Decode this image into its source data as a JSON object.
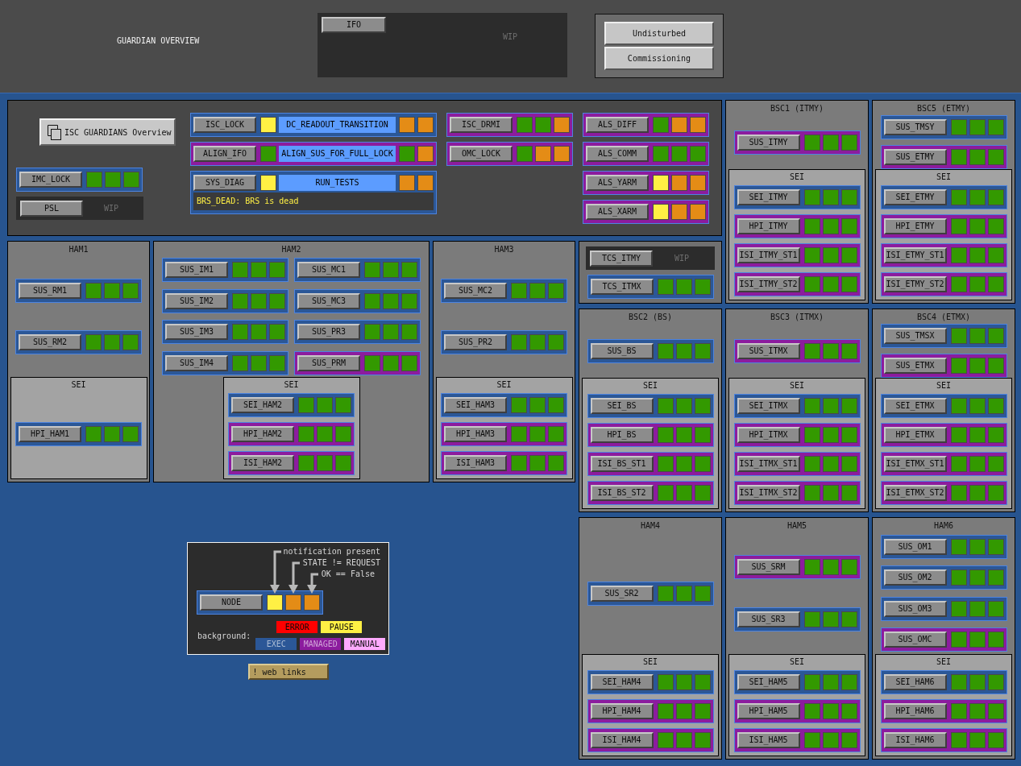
{
  "header": {
    "title": "GUARDIAN OVERVIEW",
    "ifo": {
      "name": "IFO",
      "label": "WIP"
    },
    "modes": [
      "Undisturbed",
      "Commissioning"
    ]
  },
  "isc": {
    "overview_button": "ISC GUARDIANS Overview",
    "columns": [
      [
        {
          "kind": "node",
          "name": "IMC_LOCK",
          "managed": false,
          "notification": false,
          "state_differs": false,
          "not_ok": false
        },
        {
          "kind": "wip",
          "name": "PSL",
          "label": "WIP"
        }
      ],
      [
        {
          "kind": "node",
          "name": "ISC_LOCK",
          "managed": false,
          "notification": true,
          "state": "DC_READOUT_TRANSITION",
          "state_differs": true,
          "not_ok": true
        },
        {
          "kind": "node",
          "name": "ALIGN_IFO",
          "managed": true,
          "notification": false,
          "state": "ALIGN_SUS_FOR_FULL_LOCK",
          "state_differs": false,
          "not_ok": true
        },
        {
          "kind": "node",
          "name": "SYS_DIAG",
          "managed": false,
          "notification": true,
          "state": "RUN_TESTS",
          "state_differs": true,
          "not_ok": true,
          "message": "BRS_DEAD: BRS is dead"
        }
      ],
      [
        {
          "kind": "node",
          "name": "ISC_DRMI",
          "managed": true,
          "notification": false,
          "state_differs": false,
          "not_ok": true
        },
        {
          "kind": "node",
          "name": "OMC_LOCK",
          "managed": true,
          "notification": false,
          "state_differs": true,
          "not_ok": true
        }
      ],
      [
        {
          "kind": "node",
          "name": "ALS_DIFF",
          "managed": true,
          "notification": false,
          "state_differs": true,
          "not_ok": true
        },
        {
          "kind": "node",
          "name": "ALS_COMM",
          "managed": true,
          "notification": false,
          "state_differs": false,
          "not_ok": false
        },
        {
          "kind": "node",
          "name": "ALS_YARM",
          "managed": true,
          "notification": true,
          "state_differs": true,
          "not_ok": true
        },
        {
          "kind": "node",
          "name": "ALS_XARM",
          "managed": true,
          "notification": true,
          "state_differs": true,
          "not_ok": true
        }
      ]
    ]
  },
  "bsc_top": [
    {
      "title": "BSC1 (ITMY)",
      "nodes": [
        {
          "name": "SUS_ITMY",
          "managed": true,
          "notification": false,
          "state_differs": false,
          "not_ok": false
        }
      ],
      "sei": {
        "title": "SEI",
        "nodes": [
          {
            "name": "SEI_ITMY",
            "managed": false,
            "notification": false,
            "state_differs": false,
            "not_ok": false
          },
          {
            "name": "HPI_ITMY",
            "managed": true,
            "notification": false,
            "state_differs": false,
            "not_ok": false
          },
          {
            "name": "ISI_ITMY_ST1",
            "managed": true,
            "notification": false,
            "state_differs": false,
            "not_ok": false
          },
          {
            "name": "ISI_ITMY_ST2",
            "managed": true,
            "notification": false,
            "state_differs": false,
            "not_ok": false
          }
        ]
      }
    },
    {
      "title": "BSC5 (ETMY)",
      "nodes": [
        {
          "name": "SUS_TMSY",
          "managed": false,
          "notification": false,
          "state_differs": false,
          "not_ok": false
        },
        {
          "name": "SUS_ETMY",
          "managed": true,
          "notification": false,
          "state_differs": false,
          "not_ok": false
        }
      ],
      "sei": {
        "title": "SEI",
        "nodes": [
          {
            "name": "SEI_ETMY",
            "managed": false,
            "notification": false,
            "state_differs": false,
            "not_ok": false
          },
          {
            "name": "HPI_ETMY",
            "managed": true,
            "notification": false,
            "state_differs": false,
            "not_ok": false
          },
          {
            "name": "ISI_ETMY_ST1",
            "managed": true,
            "notification": false,
            "state_differs": false,
            "not_ok": false
          },
          {
            "name": "ISI_ETMY_ST2",
            "managed": true,
            "notification": false,
            "state_differs": false,
            "not_ok": false
          }
        ]
      }
    }
  ],
  "ham_row": [
    {
      "title": "HAM1",
      "nodes": [
        {
          "name": "SUS_RM1",
          "managed": false,
          "notification": false,
          "state_differs": false,
          "not_ok": false
        },
        {
          "name": "SUS_RM2",
          "managed": false,
          "notification": false,
          "state_differs": false,
          "not_ok": false
        }
      ],
      "sei": {
        "title": "SEI",
        "nodes": [
          {
            "name": "HPI_HAM1",
            "managed": false,
            "notification": false,
            "state_differs": false,
            "not_ok": false
          }
        ]
      }
    },
    {
      "title": "HAM2",
      "nodes": [
        {
          "name": "SUS_IM1",
          "managed": false,
          "notification": false,
          "state_differs": false,
          "not_ok": false
        },
        {
          "name": "SUS_IM2",
          "managed": false,
          "notification": false,
          "state_differs": false,
          "not_ok": false
        },
        {
          "name": "SUS_IM3",
          "managed": false,
          "notification": false,
          "state_differs": false,
          "not_ok": false
        },
        {
          "name": "SUS_IM4",
          "managed": false,
          "notification": false,
          "state_differs": false,
          "not_ok": false
        },
        {
          "name": "SUS_MC1",
          "managed": false,
          "notification": false,
          "state_differs": false,
          "not_ok": false
        },
        {
          "name": "SUS_MC3",
          "managed": false,
          "notification": false,
          "state_differs": false,
          "not_ok": false
        },
        {
          "name": "SUS_PR3",
          "managed": false,
          "notification": false,
          "state_differs": false,
          "not_ok": false
        },
        {
          "name": "SUS_PRM",
          "managed": true,
          "notification": false,
          "state_differs": false,
          "not_ok": false
        }
      ],
      "sei": {
        "title": "SEI",
        "nodes": [
          {
            "name": "SEI_HAM2",
            "managed": false,
            "notification": false,
            "state_differs": false,
            "not_ok": false
          },
          {
            "name": "HPI_HAM2",
            "managed": true,
            "notification": false,
            "state_differs": false,
            "not_ok": false
          },
          {
            "name": "ISI_HAM2",
            "managed": true,
            "notification": false,
            "state_differs": false,
            "not_ok": false
          }
        ]
      }
    },
    {
      "title": "HAM3",
      "nodes": [
        {
          "name": "SUS_MC2",
          "managed": false,
          "notification": false,
          "state_differs": false,
          "not_ok": false
        },
        {
          "name": "SUS_PR2",
          "managed": false,
          "notification": false,
          "state_differs": false,
          "not_ok": false
        }
      ],
      "sei": {
        "title": "SEI",
        "nodes": [
          {
            "name": "SEI_HAM3",
            "managed": false,
            "notification": false,
            "state_differs": false,
            "not_ok": false
          },
          {
            "name": "HPI_HAM3",
            "managed": true,
            "notification": false,
            "state_differs": false,
            "not_ok": false
          },
          {
            "name": "ISI_HAM3",
            "managed": true,
            "notification": false,
            "state_differs": false,
            "not_ok": false
          }
        ]
      }
    }
  ],
  "tcs": {
    "items": [
      {
        "kind": "wip",
        "name": "TCS_ITMY",
        "label": "WIP"
      },
      {
        "kind": "node",
        "name": "TCS_ITMX",
        "managed": false,
        "notification": false,
        "state_differs": false,
        "not_ok": false
      }
    ]
  },
  "bsc_bottom": [
    {
      "title": "BSC2 (BS)",
      "nodes": [
        {
          "name": "SUS_BS",
          "managed": false,
          "notification": false,
          "state_differs": false,
          "not_ok": false
        }
      ],
      "sei": {
        "title": "SEI",
        "nodes": [
          {
            "name": "SEI_BS",
            "managed": false,
            "notification": false,
            "state_differs": false,
            "not_ok": false
          },
          {
            "name": "HPI_BS",
            "managed": true,
            "notification": false,
            "state_differs": false,
            "not_ok": false
          },
          {
            "name": "ISI_BS_ST1",
            "managed": true,
            "notification": false,
            "state_differs": false,
            "not_ok": false
          },
          {
            "name": "ISI_BS_ST2",
            "managed": true,
            "notification": false,
            "state_differs": false,
            "not_ok": false
          }
        ]
      }
    },
    {
      "title": "BSC3 (ITMX)",
      "nodes": [
        {
          "name": "SUS_ITMX",
          "managed": true,
          "notification": false,
          "state_differs": false,
          "not_ok": false
        }
      ],
      "sei": {
        "title": "SEI",
        "nodes": [
          {
            "name": "SEI_ITMX",
            "managed": false,
            "notification": false,
            "state_differs": false,
            "not_ok": false
          },
          {
            "name": "HPI_ITMX",
            "managed": true,
            "notification": false,
            "state_differs": false,
            "not_ok": false
          },
          {
            "name": "ISI_ITMX_ST1",
            "managed": true,
            "notification": false,
            "state_differs": false,
            "not_ok": false
          },
          {
            "name": "ISI_ITMX_ST2",
            "managed": true,
            "notification": false,
            "state_differs": false,
            "not_ok": false
          }
        ]
      }
    },
    {
      "title": "BSC4 (ETMX)",
      "nodes": [
        {
          "name": "SUS_TMSX",
          "managed": false,
          "notification": false,
          "state_differs": false,
          "not_ok": false
        },
        {
          "name": "SUS_ETMX",
          "managed": true,
          "notification": false,
          "state_differs": false,
          "not_ok": false
        }
      ],
      "sei": {
        "title": "SEI",
        "nodes": [
          {
            "name": "SEI_ETMX",
            "managed": false,
            "notification": false,
            "state_differs": false,
            "not_ok": false
          },
          {
            "name": "HPI_ETMX",
            "managed": true,
            "notification": false,
            "state_differs": false,
            "not_ok": false
          },
          {
            "name": "ISI_ETMX_ST1",
            "managed": true,
            "notification": false,
            "state_differs": false,
            "not_ok": false
          },
          {
            "name": "ISI_ETMX_ST2",
            "managed": true,
            "notification": false,
            "state_differs": false,
            "not_ok": false
          }
        ]
      }
    }
  ],
  "legend": {
    "notes": [
      "notification present",
      "STATE != REQUEST",
      "OK == False"
    ],
    "example": {
      "name": "NODE",
      "managed": false,
      "notification": true,
      "state_differs": true,
      "not_ok": true
    },
    "background_label": "background:",
    "swatches": [
      [
        {
          "label": "ERROR",
          "color": "#ff0000"
        },
        {
          "label": "PAUSE",
          "color": "#fff044"
        }
      ],
      [
        {
          "label": "EXEC",
          "color": "#2b5797"
        },
        {
          "label": "MANAGED",
          "color": "#8c1c9e"
        },
        {
          "label": "MANUAL",
          "color": "#ffaaff"
        }
      ]
    ]
  },
  "web_links": "! web links",
  "ham_bottom": [
    {
      "title": "HAM4",
      "nodes": [
        {
          "name": "SUS_SR2",
          "managed": false,
          "notification": false,
          "state_differs": false,
          "not_ok": false
        }
      ],
      "sei": {
        "title": "SEI",
        "nodes": [
          {
            "name": "SEI_HAM4",
            "managed": false,
            "notification": false,
            "state_differs": false,
            "not_ok": false
          },
          {
            "name": "HPI_HAM4",
            "managed": true,
            "notification": false,
            "state_differs": false,
            "not_ok": false
          },
          {
            "name": "ISI_HAM4",
            "managed": true,
            "notification": false,
            "state_differs": false,
            "not_ok": false
          }
        ]
      }
    },
    {
      "title": "HAM5",
      "nodes": [
        {
          "name": "SUS_SRM",
          "managed": true,
          "notification": false,
          "state_differs": false,
          "not_ok": false
        },
        {
          "name": "SUS_SR3",
          "managed": false,
          "notification": false,
          "state_differs": false,
          "not_ok": false
        }
      ],
      "sei": {
        "title": "SEI",
        "nodes": [
          {
            "name": "SEI_HAM5",
            "managed": false,
            "notification": false,
            "state_differs": false,
            "not_ok": false
          },
          {
            "name": "HPI_HAM5",
            "managed": true,
            "notification": false,
            "state_differs": false,
            "not_ok": false
          },
          {
            "name": "ISI_HAM5",
            "managed": true,
            "notification": false,
            "state_differs": false,
            "not_ok": false
          }
        ]
      }
    },
    {
      "title": "HAM6",
      "nodes": [
        {
          "name": "SUS_OM1",
          "managed": false,
          "notification": false,
          "state_differs": false,
          "not_ok": false
        },
        {
          "name": "SUS_OM2",
          "managed": false,
          "notification": false,
          "state_differs": false,
          "not_ok": false
        },
        {
          "name": "SUS_OM3",
          "managed": false,
          "notification": false,
          "state_differs": false,
          "not_ok": false
        },
        {
          "name": "SUS_OMC",
          "managed": true,
          "notification": false,
          "state_differs": false,
          "not_ok": false
        }
      ],
      "sei": {
        "title": "SEI",
        "nodes": [
          {
            "name": "SEI_HAM6",
            "managed": false,
            "notification": false,
            "state_differs": false,
            "not_ok": false
          },
          {
            "name": "HPI_HAM6",
            "managed": true,
            "notification": false,
            "state_differs": false,
            "not_ok": false
          },
          {
            "name": "ISI_HAM6",
            "managed": true,
            "notification": false,
            "state_differs": false,
            "not_ok": false
          }
        ]
      }
    }
  ]
}
